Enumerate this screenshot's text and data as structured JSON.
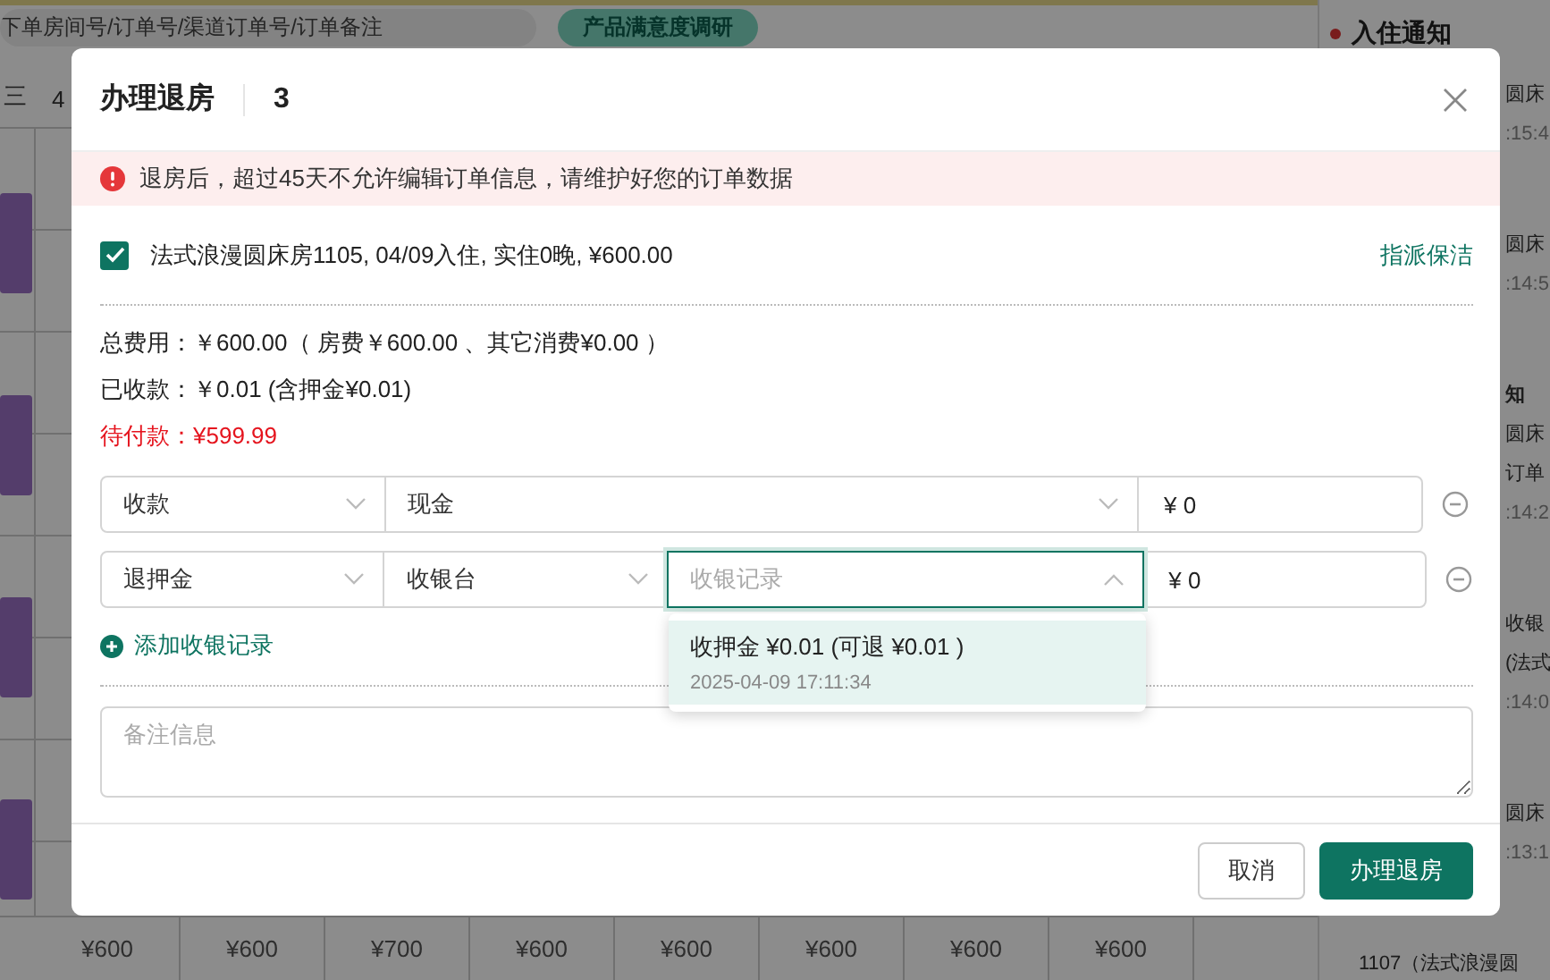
{
  "background": {
    "search": {
      "placeholder": "下单房间号/订单号/渠道订单号/订单备注"
    },
    "survey_button": "产品满意度调研",
    "calendar_header": [
      "三",
      "4"
    ],
    "prices": [
      "¥600",
      "¥600",
      "¥700",
      "¥600",
      "¥600",
      "¥600",
      "¥600",
      "¥600"
    ],
    "notifications": {
      "title": "入住通知",
      "lines": [
        {
          "text": "圆床",
          "kind": "text"
        },
        {
          "text": ":15:4",
          "kind": "time"
        },
        {
          "text": "圆床",
          "kind": "text"
        },
        {
          "text": ":14:5",
          "kind": "time"
        },
        {
          "text": "知",
          "kind": "title"
        },
        {
          "text": "圆床",
          "kind": "text"
        },
        {
          "text": "订单",
          "kind": "text"
        },
        {
          "text": ":14:2",
          "kind": "time"
        },
        {
          "text": "收银",
          "kind": "text"
        },
        {
          "text": "(法式",
          "kind": "text"
        },
        {
          "text": ":14:0",
          "kind": "time"
        },
        {
          "text": "圆床",
          "kind": "text"
        },
        {
          "text": ":13:1",
          "kind": "time"
        },
        {
          "text": "1107（法式浪漫圆",
          "kind": "detail"
        }
      ]
    }
  },
  "modal": {
    "title": "办理退房",
    "count": "3",
    "alert": "退房后，超过45天不允许编辑订单信息，请维护好您的订单数据",
    "order": {
      "checked": true,
      "label": "法式浪漫圆床房1105, 04/09入住, 实住0晚, ¥600.00"
    },
    "assign_cleaning": "指派保洁",
    "summary": [
      {
        "text": "总费用：￥600.00（ 房费￥600.00 、其它消费¥0.00 ）",
        "kind": "normal"
      },
      {
        "text": "已收款：￥0.01 (含押金¥0.01)",
        "kind": "normal"
      },
      {
        "text": "待付款：¥599.99",
        "kind": "due"
      }
    ],
    "payment_rows": [
      {
        "type": "收款",
        "method": "现金",
        "amount": "¥ 0"
      },
      {
        "type": "退押金",
        "method": "收银台",
        "record": {
          "placeholder": "收银记录",
          "expanded": true
        },
        "amount": "¥ 0"
      }
    ],
    "add_record": "添加收银记录",
    "remark": {
      "placeholder": "备注信息"
    },
    "dropdown": [
      {
        "title": "收押金 ¥0.01 (可退 ¥0.01 )",
        "time": "2025-04-09 17:11:34",
        "selected": true
      }
    ],
    "buttons": [
      {
        "label": "取消",
        "kind": "secondary"
      },
      {
        "label": "办理退房",
        "kind": "primary"
      }
    ]
  }
}
